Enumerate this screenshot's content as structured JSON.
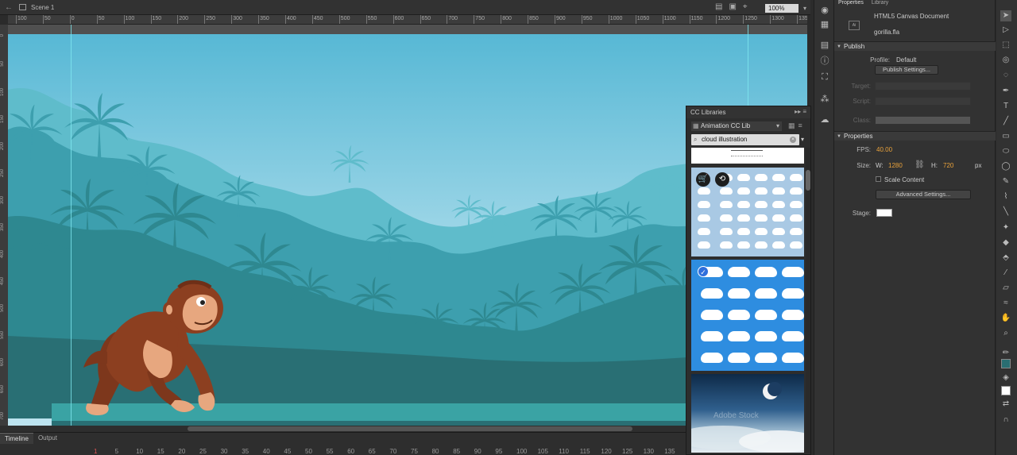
{
  "topbar": {
    "back_icon": "back-arrow-icon",
    "scene_label": "Scene 1",
    "zoom_value": "100%"
  },
  "ruler": {
    "h_ticks": [
      "100",
      "50",
      "0",
      "50",
      "100",
      "150",
      "200",
      "250",
      "300",
      "350",
      "400",
      "450",
      "500",
      "550",
      "600",
      "650",
      "700",
      "750",
      "800",
      "850",
      "900",
      "950",
      "1000",
      "1050",
      "1100",
      "1150",
      "1200",
      "1250",
      "1300",
      "1350"
    ],
    "v_ticks": [
      "0",
      "50",
      "100",
      "150",
      "200",
      "250",
      "300",
      "350",
      "400",
      "450",
      "500",
      "550",
      "600",
      "650",
      "700"
    ]
  },
  "timeline": {
    "tabs": [
      "Timeline",
      "Output"
    ],
    "frame_numbers": [
      "1",
      "5",
      "10",
      "15",
      "20",
      "25",
      "30",
      "35",
      "40",
      "45",
      "50",
      "55",
      "60",
      "65",
      "70",
      "75",
      "80",
      "85",
      "90",
      "95",
      "100",
      "105",
      "110",
      "115",
      "120",
      "125",
      "130",
      "135"
    ]
  },
  "cc_libraries": {
    "title": "CC Libraries",
    "library_name": "Animation CC Lib",
    "search_value": "cloud illustration",
    "results": [
      {
        "name": "stock-result-partial"
      },
      {
        "name": "stock-result-cloud-set-light"
      },
      {
        "name": "stock-result-cloud-set-blue"
      },
      {
        "name": "stock-result-sky-moon"
      }
    ],
    "watermark": "Adobe Stock"
  },
  "properties": {
    "tabs": [
      "Properties",
      "Library"
    ],
    "doc_type": "HTML5 Canvas Document",
    "doc_name": "gorilla.fla",
    "publish_section": "Publish",
    "profile_label": "Profile:",
    "profile_value": "Default",
    "publish_settings_btn": "Publish Settings...",
    "target_label": "Target:",
    "script_label": "Script:",
    "class_label": "Class:",
    "properties_section": "Properties",
    "fps_label": "FPS:",
    "fps_value": "40.00",
    "size_label": "Size:",
    "w_label": "W:",
    "w_value": "1280",
    "h_label": "H:",
    "h_value": "720",
    "unit": "px",
    "scale_content_label": "Scale Content",
    "advanced_settings_btn": "Advanced Settings...",
    "stage_label": "Stage:",
    "stage_color": "#ffffff"
  },
  "colors": {
    "sky_top": "#57b8d5",
    "sky_bottom": "#b6e0ec",
    "jungle_far": "#59b8c8",
    "jungle_mid": "#3b9aa8",
    "jungle_near": "#2b7e84",
    "ground": "#2a6e72",
    "gorilla": "#8c3f20",
    "gorilla_skin": "#e7a77f",
    "accent_orange": "#e9a23b"
  }
}
